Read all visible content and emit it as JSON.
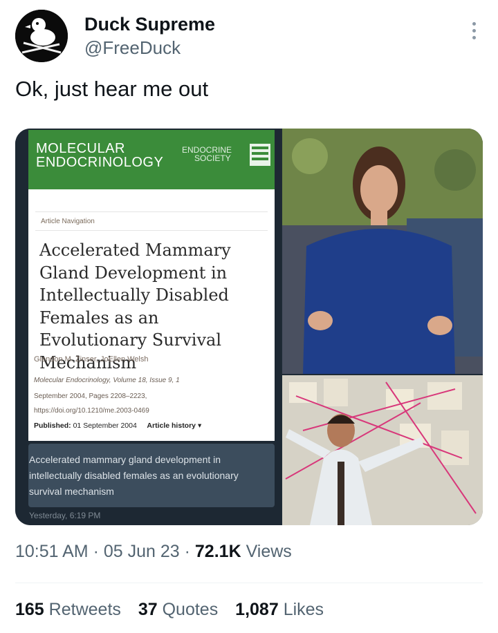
{
  "author": {
    "display_name": "Duck Supreme",
    "handle": "@FreeDuck",
    "avatar_icon": "duck-skull-crossbones-icon"
  },
  "more_icon": "more-vertical-icon",
  "tweet": {
    "text": "Ok, just hear me out"
  },
  "media": {
    "journal": {
      "name_line1": "MOLECULAR",
      "name_line2": "ENDOCRINOLOGY",
      "society_line1": "ENDOCRINE",
      "society_line2": "SOCIETY",
      "brand_color": "#3b8c3a"
    },
    "article": {
      "nav_label": "Article Navigation",
      "title": "Accelerated Mammary Gland Development in Intellectually Disabled Females as an Evolutionary Survival Mechanism",
      "authors": "Glendon M. Zinser, JoEllen Welsh",
      "citation_journal": "Molecular Endocrinology, Volume 18, Issue 9, 1",
      "citation_date": "September 2004, Pages 2208–2223,",
      "doi": "https://doi.org/10.1210/me.2003-0469",
      "published_label": "Published:",
      "published_date": "01 September 2004",
      "history_label": "Article history ▾"
    },
    "caption": "Accelerated mammary gland development in intellectually disabled females as an evolutionary survival mechanism",
    "caption_time": "Yesterday, 6:19 PM"
  },
  "meta": {
    "time": "10:51 AM",
    "sep1": " · ",
    "date": "05 Jun 23",
    "sep2": " · ",
    "views_count": "72.1K",
    "views_label": " Views"
  },
  "stats": {
    "retweets_count": "165",
    "retweets_label": "Retweets",
    "quotes_count": "37",
    "quotes_label": "Quotes",
    "likes_count": "1,087",
    "likes_label": "Likes"
  }
}
